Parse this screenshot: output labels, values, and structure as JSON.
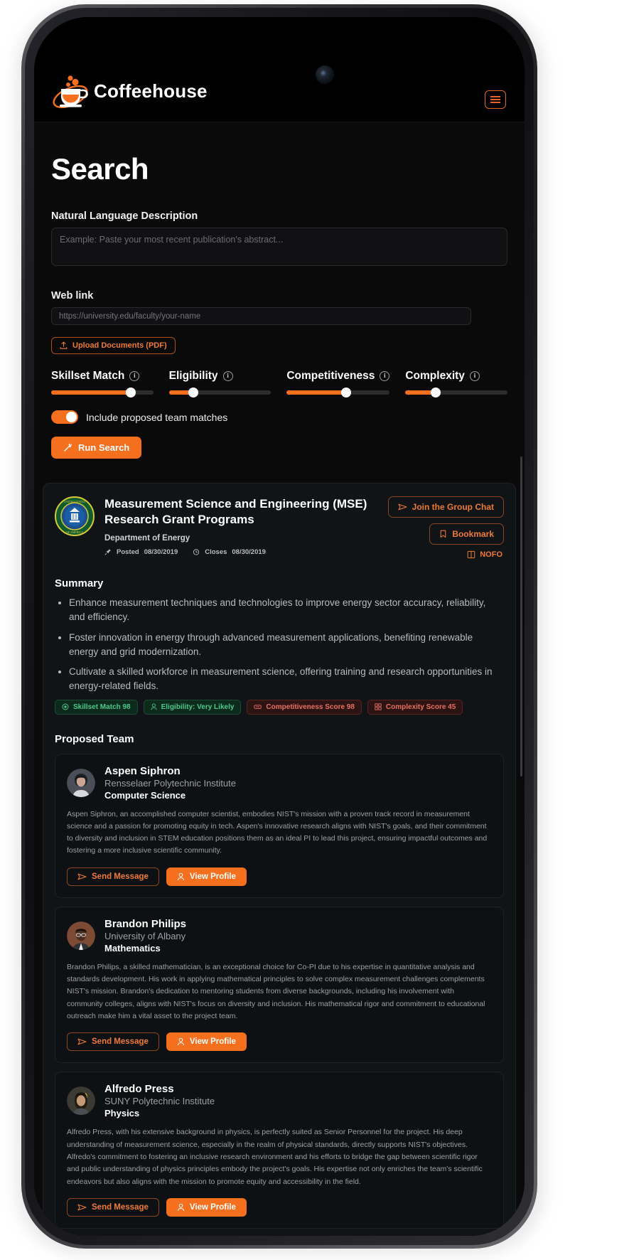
{
  "header": {
    "brand_name": "Coffeehouse",
    "logo_icon": "coffee-cup-icon",
    "menu_icon": "hamburger-menu-icon"
  },
  "search": {
    "title": "Search",
    "description_label": "Natural Language Description",
    "description_placeholder": "Example: Paste your most recent publication's abstract...",
    "description_value": "",
    "weblink_label": "Web link",
    "weblink_placeholder": "https://university.edu/faculty/your-name",
    "weblink_value": "",
    "upload_label": "Upload Documents (PDF)",
    "upload_icon": "upload-icon",
    "sliders": [
      {
        "label": "Skillset Match",
        "percent": 78,
        "info_icon": "info-icon"
      },
      {
        "label": "Eligibility",
        "percent": 24,
        "info_icon": "info-icon"
      },
      {
        "label": "Competitiveness",
        "percent": 58,
        "info_icon": "info-icon"
      },
      {
        "label": "Complexity",
        "percent": 30,
        "info_icon": "info-icon"
      }
    ],
    "toggle_label": "Include proposed team matches",
    "toggle_state": "on",
    "run_label": "Run Search",
    "run_icon": "magic-wand-icon"
  },
  "result": {
    "seal_icon": "department-of-energy-seal",
    "grant_title": "Measurement Science and Engineering (MSE) Research Grant Programs",
    "agency": "Department of Energy",
    "posted_icon": "pin-icon",
    "posted_label": "Posted",
    "posted_date": "08/30/2019",
    "closes_icon": "clock-icon",
    "closes_label": "Closes",
    "closes_date": "08/30/2019",
    "join_chat_label": "Join the Group Chat",
    "join_chat_icon": "send-icon",
    "bookmark_label": "Bookmark",
    "bookmark_icon": "bookmark-icon",
    "nofo_label": "NOFO",
    "nofo_icon": "document-icon",
    "summary_heading": "Summary",
    "summary_bullets": [
      "Enhance measurement techniques and technologies to improve energy sector accuracy, reliability, and efficiency.",
      "Foster innovation in energy through advanced measurement applications, benefiting renewable energy and grid modernization.",
      "Cultivate a skilled workforce in measurement science, offering training and research opportunities in energy-related fields."
    ],
    "badges": [
      {
        "label": "Skillset Match 98",
        "tone": "green",
        "icon": "target-icon"
      },
      {
        "label": "Eligibility: Very Likely",
        "tone": "green",
        "icon": "person-icon"
      },
      {
        "label": "Competitiveness Score 98",
        "tone": "red",
        "icon": "gauge-icon"
      },
      {
        "label": "Complexity Score 45",
        "tone": "red",
        "icon": "blocks-icon"
      }
    ],
    "team_heading": "Proposed Team",
    "team": [
      {
        "name": "Aspen Siphron",
        "org": "Rensselaer Polytechnic Institute",
        "dept": "Computer Science",
        "bio": "Aspen Siphron, an accomplished computer scientist, embodies NIST's mission with a proven track record in measurement science and a passion for promoting equity in tech. Aspen's innovative research aligns with NIST's goals, and their commitment to diversity and inclusion in STEM education positions them as an ideal PI to lead this project, ensuring impactful outcomes and fostering a more inclusive scientific community.",
        "send_label": "Send Message",
        "send_icon": "send-icon",
        "view_label": "View Profile",
        "view_icon": "person-icon",
        "avatar_icon": "avatar-photo"
      },
      {
        "name": "Brandon Philips",
        "org": "University of Albany",
        "dept": "Mathematics",
        "bio": "Brandon Philips, a skilled mathematician, is an exceptional choice for Co-PI due to his expertise in quantitative analysis and standards development. His work in applying mathematical principles to solve complex measurement challenges complements NIST's mission. Brandon's dedication to mentoring students from diverse backgrounds, including his involvement with community colleges, aligns with NIST's focus on diversity and inclusion. His mathematical rigor and commitment to educational outreach make him a vital asset to the project team.",
        "send_label": "Send Message",
        "send_icon": "send-icon",
        "view_label": "View Profile",
        "view_icon": "person-icon",
        "avatar_icon": "avatar-photo"
      },
      {
        "name": "Alfredo Press",
        "org": "SUNY Polytechnic Institute",
        "dept": "Physics",
        "bio": "Alfredo Press, with his extensive background in physics, is perfectly suited as Senior Personnel for the project. His deep understanding of measurement science, especially in the realm of physical standards, directly supports NIST's objectives. Alfredo's commitment to fostering an inclusive research environment and his efforts to bridge the gap between scientific rigor and public understanding of physics principles embody the project's goals. His expertise not only enriches the team's scientific endeavors but also aligns with the mission to promote equity and accessibility in the field.",
        "send_label": "Send Message",
        "send_icon": "send-icon",
        "view_label": "View Profile",
        "view_icon": "person-icon",
        "avatar_icon": "avatar-photo"
      }
    ]
  },
  "colors": {
    "accent": "#f4701f",
    "accent_text": "#ef7a33",
    "page_bg": "#0a0a0a",
    "card_bg": "#101416",
    "green_badge": "#49c98a",
    "red_badge": "#e87060"
  }
}
